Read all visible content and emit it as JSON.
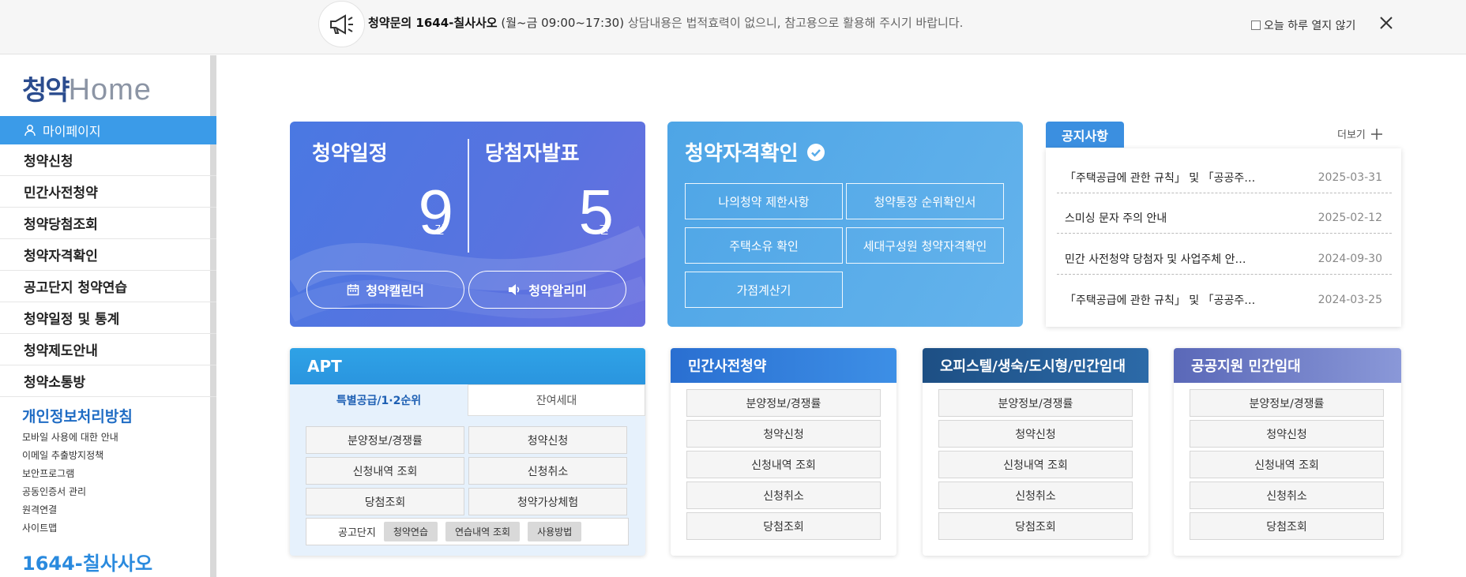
{
  "topbar": {
    "notice_bold": "청약문의 1644-칠사사오",
    "notice_hours": "(월~금 09:00~17:30)",
    "notice_rest": "상담내용은 법적효력이 없으니, 참고용으로 활용해 주시기 바랍니다.",
    "dont_show_label": "오늘 하루 열지 않기"
  },
  "logo": {
    "kr": "청약",
    "en": "Home"
  },
  "sidebar": {
    "mypage_label": "마이페이지",
    "items": [
      {
        "label": "청약신청"
      },
      {
        "label": "민간사전청약"
      },
      {
        "label": "청약당첨조회"
      },
      {
        "label": "청약자격확인"
      },
      {
        "label": "공고단지 청약연습"
      },
      {
        "label": "청약일정 및 통계"
      },
      {
        "label": "청약제도안내"
      },
      {
        "label": "청약소통방"
      }
    ],
    "privacy_title": "개인정보처리방침",
    "sublinks": [
      "모바일 사용에 대한 안내",
      "이메일 추출방지정책",
      "보안프로그램",
      "공동인증서 관리",
      "원격연결",
      "사이트맵"
    ],
    "phone": "1644-칠사사오"
  },
  "schedule": {
    "title1": "청약일정",
    "count1": "9",
    "title2": "당첨자발표",
    "count2": "5",
    "unit": "건",
    "calendar_btn": "청약캘린더",
    "alarm_btn": "청약알리미"
  },
  "eligibility": {
    "title": "청약자격확인",
    "buttons": [
      "나의청약 제한사항",
      "청약통장 순위확인서",
      "주택소유 확인",
      "세대구성원 청약자격확인",
      "가점계산기"
    ]
  },
  "notices": {
    "tab_label": "공지사항",
    "more_label": "더보기",
    "items": [
      {
        "title": "「주택공급에 관한 규칙」 및 「공공주…",
        "date": "2025-03-31"
      },
      {
        "title": "스미싱 문자 주의 안내",
        "date": "2025-02-12"
      },
      {
        "title": "민간 사전청약 당첨자 및 사업주체 안…",
        "date": "2024-09-30"
      },
      {
        "title": "「주택공급에 관한 규칙」 및 「공공주…",
        "date": "2024-03-25"
      }
    ]
  },
  "apt": {
    "title": "APT",
    "tab1": "특별공급/1·2순위",
    "tab2": "잔여세대",
    "buttons": [
      "분양정보/경쟁률",
      "청약신청",
      "신청내역 조회",
      "신청취소",
      "당첨조회",
      "청약가상체험"
    ],
    "practice_label": "공고단지",
    "practice_chips": [
      "청약연습",
      "연습내역 조회",
      "사용방법"
    ]
  },
  "panels": [
    {
      "title": "민간사전청약",
      "buttons": [
        "분양정보/경쟁률",
        "청약신청",
        "신청내역 조회",
        "신청취소",
        "당첨조회"
      ]
    },
    {
      "title": "오피스텔/생숙/도시형/민간임대",
      "buttons": [
        "분양정보/경쟁률",
        "청약신청",
        "신청내역 조회",
        "신청취소",
        "당첨조회"
      ]
    },
    {
      "title": "공공지원 민간임대",
      "buttons": [
        "분양정보/경쟁률",
        "청약신청",
        "신청내역 조회",
        "신청취소",
        "당첨조회"
      ]
    }
  ],
  "colors": {
    "primary": "#3b9be8",
    "navy": "#2b4c8e",
    "schedule_card": "#5873e0",
    "elig_card": "#58acea"
  }
}
